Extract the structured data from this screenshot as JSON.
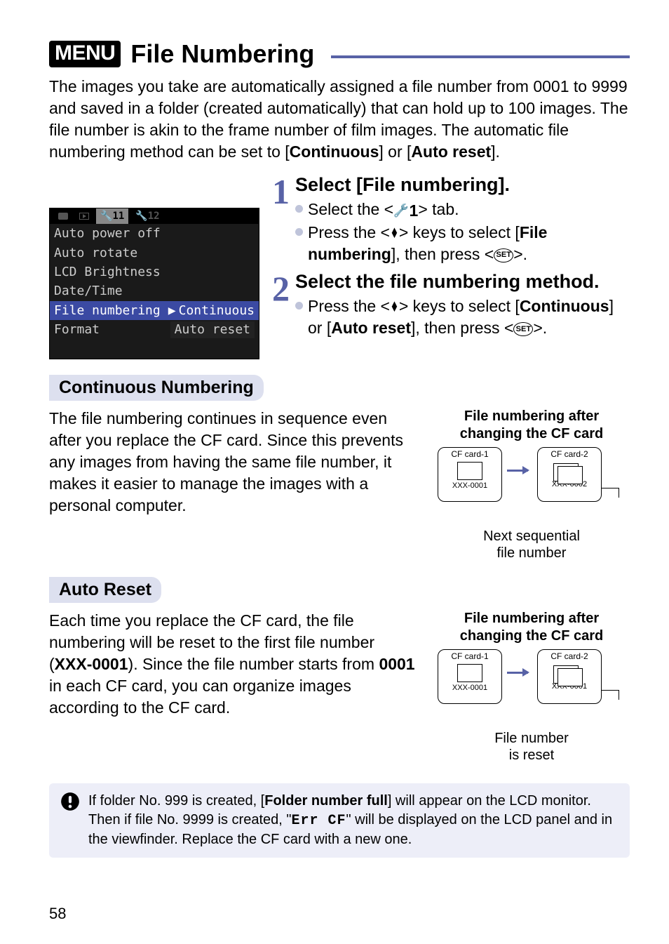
{
  "header": {
    "menu_label": "MENU",
    "title": "File Numbering"
  },
  "intro": {
    "part1": "The images you take are automatically assigned a file number from 0001 to 9999 and saved in a folder (created automatically) that can hold up to 100 images. The file number is akin to the frame number of film images. The automatic file numbering method can be set to [",
    "bold1": "Continuous",
    "part2": "] or [",
    "bold2": "Auto reset",
    "part3": "]."
  },
  "lcd": {
    "tab_active": "11",
    "tab_next": "12",
    "rows": {
      "auto_power_off": "Auto power off",
      "auto_rotate": "Auto rotate",
      "lcd_brightness": "LCD Brightness",
      "date_time": "Date/Time",
      "file_numbering": "File numbering",
      "file_numbering_val": "Continuous",
      "format": "Format",
      "format_opt": "Auto reset"
    }
  },
  "steps": {
    "s1": {
      "num": "1",
      "title": "Select [File numbering].",
      "b1_a": "Select the <",
      "b1_tab": "1",
      "b1_c": "> tab.",
      "b2_a": "Press the <",
      "b2_b": "> keys to select [",
      "b2_bold": "File numbering",
      "b2_c": "], then press <",
      "b2_d": ">.",
      "set": "SET"
    },
    "s2": {
      "num": "2",
      "title": "Select the file numbering method.",
      "b1_a": "Press the <",
      "b1_b": "> keys to select [",
      "b1_bold1": "Continuous",
      "b1_c": "] or [",
      "b1_bold2": "Auto reset",
      "b1_d": "], then press <",
      "b1_e": ">.",
      "set": "SET"
    }
  },
  "continuous": {
    "heading": "Continuous Numbering",
    "body": "The file numbering continues in sequence even after you replace the CF card. Since this prevents any images from having the same file number, it makes it easier to manage the images with a personal computer.",
    "right_title": "File numbering after changing the CF card",
    "card1_label": "CF card-1",
    "card1_fn": "XXX-0001",
    "card2_label": "CF card-2",
    "card2_fn": "XXX-0002",
    "caption": "Next sequential file number"
  },
  "autoreset": {
    "heading": "Auto Reset",
    "body_a": "Each time you replace the CF card, the file numbering will be reset to the first file number (",
    "body_bold1": "XXX-0001",
    "body_b": "). Since the file number starts from ",
    "body_bold2": "0001",
    "body_c": " in each CF card, you can organize images according to the CF card.",
    "right_title": "File numbering after changing the CF card",
    "card1_label": "CF card-1",
    "card1_fn": "XXX-0001",
    "card2_label": "CF card-2",
    "card2_fn": "XXX-0001",
    "caption": "File number is reset"
  },
  "warning": {
    "a": "If folder No. 999 is created, [",
    "bold": "Folder number full",
    "b": "] will appear on the LCD monitor. Then if file No. 9999 is created, \"",
    "lcd": "Err  CF",
    "c": "\" will be displayed on the LCD panel and in the viewfinder. Replace the CF card with a new one."
  },
  "page_number": "58"
}
